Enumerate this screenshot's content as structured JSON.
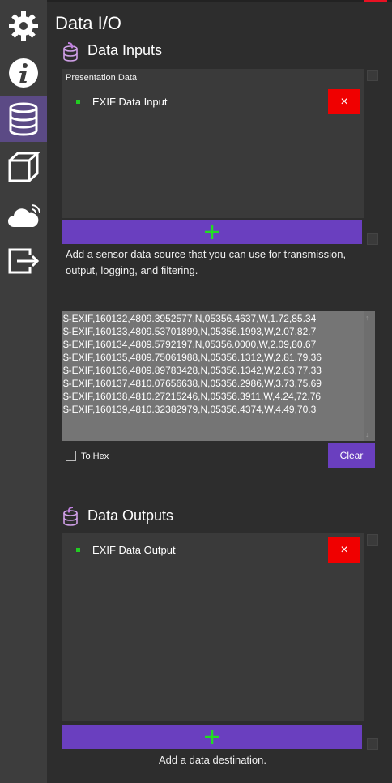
{
  "window": {
    "title": "Data I/O"
  },
  "sidebar": {
    "items": [
      {
        "icon": "gear-icon"
      },
      {
        "icon": "info-icon"
      },
      {
        "icon": "database-icon"
      },
      {
        "icon": "cube-icon"
      },
      {
        "icon": "cloud-icon"
      },
      {
        "icon": "export-icon"
      }
    ]
  },
  "inputs": {
    "title": "Data Inputs",
    "group_label": "Presentation Data",
    "items": [
      {
        "label": "EXIF Data Input"
      }
    ],
    "remove_label": "×",
    "add_label": "+",
    "help": "Add a sensor data source that you can use for transmission, output, logging, and filtering."
  },
  "log": {
    "lines": [
      "$-EXIF,160132,4809.3952577,N,05356.4637,W,1.72,85.34",
      "$-EXIF,160133,4809.53701899,N,05356.1993,W,2.07,82.7",
      "$-EXIF,160134,4809.5792197,N,05356.0000,W,2.09,80.67",
      "$-EXIF,160135,4809.75061988,N,05356.1312,W,2.81,79.36",
      "$-EXIF,160136,4809.89783428,N,05356.1342,W,2.83,77.33",
      "$-EXIF,160137,4810.07656638,N,05356.2986,W,3.73,75.69",
      "$-EXIF,160138,4810.27215246,N,05356.3911,W,4.24,72.76",
      "$-EXIF,160139,4810.32382979,N,05356.4374,W,4.49,70.3"
    ],
    "to_hex_label": "To Hex",
    "to_hex_checked": false,
    "clear_label": "Clear"
  },
  "outputs": {
    "title": "Data Outputs",
    "items": [
      {
        "label": "EXIF Data Output"
      }
    ],
    "remove_label": "×",
    "add_label": "+",
    "help": "Add a data destination."
  },
  "colors": {
    "accent": "#6a3fbf",
    "remove": "#f00000",
    "status_green": "#22cc22",
    "sidebar_active": "#5b4a85"
  }
}
